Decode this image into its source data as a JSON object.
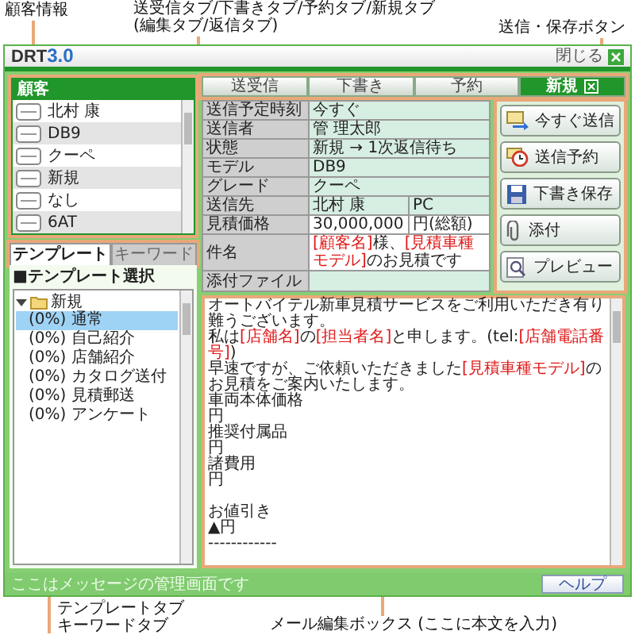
{
  "callouts": {
    "customer": "顧客情報",
    "tabs": [
      "送受信タブ/下書きタブ/予約タブ/新規タブ",
      "(編集タブ/返信タブ)"
    ],
    "buttons": "送信・保存ボタン",
    "template_tabs": [
      "テンプレートタブ",
      "キーワードタブ"
    ],
    "editor": "メール編集ボックス (ここに本文を入力)"
  },
  "window": {
    "logo": "DRT",
    "version": "3.0",
    "close_label": "閉じる"
  },
  "customer_panel": {
    "title": "顧客",
    "rows": [
      "北村 康",
      "DB9",
      "クーペ",
      "新規",
      "なし",
      "6AT"
    ]
  },
  "left_tabs": [
    {
      "label": "テンプレート",
      "selected": true
    },
    {
      "label": "キーワード",
      "selected": false
    }
  ],
  "template_panel": {
    "title": "■テンプレート選択",
    "tree": [
      {
        "label": "新規",
        "expanded": true,
        "children": [
          {
            "label": "(0%) 通常",
            "selected": true
          },
          {
            "label": "(0%) 自己紹介",
            "selected": false
          },
          {
            "label": "(0%) 店舗紹介",
            "selected": false
          },
          {
            "label": "(0%) カタログ送付",
            "selected": false
          },
          {
            "label": "(0%) 見積郵送",
            "selected": false
          },
          {
            "label": "(0%) アンケート",
            "selected": false
          }
        ]
      }
    ]
  },
  "tabs": [
    {
      "label": "送受信",
      "selected": false,
      "closable": false
    },
    {
      "label": "下書き",
      "selected": false,
      "closable": false
    },
    {
      "label": "予約",
      "selected": false,
      "closable": false
    },
    {
      "label": "新規",
      "selected": true,
      "closable": true
    }
  ],
  "form": [
    {
      "label": "送信予定時刻",
      "kind": "text",
      "value": [
        {
          "text": "今すぐ",
          "kind": "plain"
        }
      ]
    },
    {
      "label": "送信者",
      "kind": "text",
      "value": [
        {
          "text": "管 理太郎",
          "kind": "plain"
        }
      ]
    },
    {
      "label": "状態",
      "kind": "text",
      "value": [
        {
          "text": "新規 → 1次返信待ち",
          "kind": "plain"
        }
      ]
    },
    {
      "label": "モデル",
      "kind": "text",
      "value": [
        {
          "text": "DB9",
          "kind": "plain"
        }
      ]
    },
    {
      "label": "グレード",
      "kind": "text",
      "value": [
        {
          "text": "クーペ",
          "kind": "plain"
        }
      ]
    },
    {
      "label": "送信先",
      "kind": "text",
      "value": [
        {
          "text": "北村 康",
          "kind": "plain"
        }
      ],
      "extra": "PC"
    },
    {
      "label": "見積価格",
      "kind": "input",
      "value": [
        {
          "text": "30,000,000",
          "kind": "plain"
        }
      ],
      "extra": "円(総額)"
    },
    {
      "label": "件名",
      "kind": "input",
      "value": [
        {
          "text": "[顧客名]",
          "kind": "field"
        },
        {
          "text": "様、",
          "kind": "plain"
        },
        {
          "text": "[見積車種モデル]",
          "kind": "field"
        },
        {
          "text": "のお見積です",
          "kind": "plain"
        }
      ]
    },
    {
      "label": "添付ファイル",
      "kind": "area"
    }
  ],
  "buttons": [
    {
      "label": "今すぐ送信",
      "kind": "send"
    },
    {
      "label": "送信予約",
      "kind": "schedule"
    },
    {
      "label": "下書き保存",
      "kind": "save"
    },
    {
      "label": "添付",
      "kind": "attach"
    },
    {
      "label": "プレビュー",
      "kind": "preview"
    }
  ],
  "editor": [
    {
      "kind": "text",
      "segments": [
        {
          "text": "オートバイテル新車見積サービスをご利用いただき有り難うございます。",
          "kind": "plain"
        }
      ]
    },
    {
      "kind": "text",
      "segments": [
        {
          "text": "私は",
          "kind": "plain"
        },
        {
          "text": "[店舗名]",
          "kind": "field"
        },
        {
          "text": "の",
          "kind": "plain"
        },
        {
          "text": "[担当者名]",
          "kind": "field"
        },
        {
          "text": "と申します。(tel:",
          "kind": "plain"
        },
        {
          "text": "[店舗電話番号]",
          "kind": "field"
        },
        {
          "text": ")",
          "kind": "plain"
        }
      ]
    },
    {
      "kind": "text",
      "segments": [
        {
          "text": "早速ですが、ご依頼いただきました",
          "kind": "plain"
        },
        {
          "text": "[見積車種モデル]",
          "kind": "field"
        },
        {
          "text": "のお見積をご案内いたします。",
          "kind": "plain"
        }
      ]
    },
    {
      "kind": "text",
      "segments": [
        {
          "text": "車両本体価格",
          "kind": "plain"
        }
      ]
    },
    {
      "kind": "text",
      "segments": [
        {
          "text": "円",
          "kind": "plain"
        }
      ]
    },
    {
      "kind": "text",
      "segments": [
        {
          "text": "推奨付属品",
          "kind": "plain"
        }
      ]
    },
    {
      "kind": "text",
      "segments": [
        {
          "text": "円",
          "kind": "plain"
        }
      ]
    },
    {
      "kind": "text",
      "segments": [
        {
          "text": "諸費用",
          "kind": "plain"
        }
      ]
    },
    {
      "kind": "text",
      "segments": [
        {
          "text": "円",
          "kind": "plain"
        }
      ]
    },
    {
      "kind": "blank"
    },
    {
      "kind": "text",
      "segments": [
        {
          "text": "お値引き",
          "kind": "plain"
        }
      ]
    },
    {
      "kind": "text",
      "segments": [
        {
          "text": "▲円",
          "kind": "plain"
        }
      ]
    },
    {
      "kind": "text",
      "segments": [
        {
          "text": "------------",
          "kind": "plain"
        }
      ]
    }
  ],
  "status": {
    "message": "ここはメッセージの管理画面です",
    "help": "ヘルプ"
  }
}
